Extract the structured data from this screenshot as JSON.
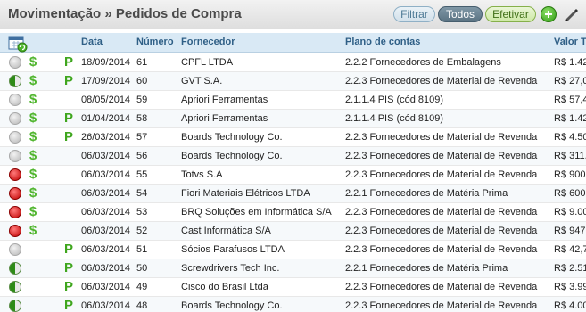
{
  "page": {
    "title": "Movimentação » Pedidos de Compra",
    "buttons": {
      "filtrar": "Filtrar",
      "todos": "Todos",
      "efetivar": "Efetivar"
    }
  },
  "columns": {
    "data": "Data",
    "numero": "Número",
    "fornecedor": "Fornecedor",
    "plano": "Plano de contas",
    "valor": "Valor T"
  },
  "colors": {
    "header_bg": "#d9e9f5",
    "header_text": "#2f5f86",
    "status_red": "#c00000",
    "status_green": "#2e8b17",
    "dollar_green": "#4fb52d"
  },
  "rows": [
    {
      "status": "gray",
      "dollar": "$",
      "p": "P",
      "date": "18/09/2014",
      "num": "61",
      "forn": "CPFL LTDA",
      "plano": "2.2.2 Fornecedores de Embalagens",
      "valor": "R$ 1.42"
    },
    {
      "status": "half",
      "dollar": "$",
      "p": "P",
      "date": "17/09/2014",
      "num": "60",
      "forn": "GVT S.A.",
      "plano": "2.2.3 Fornecedores de Material de Revenda",
      "valor": "R$ 27,0"
    },
    {
      "status": "gray",
      "dollar": "$",
      "p": "",
      "date": "08/05/2014",
      "num": "59",
      "forn": "Apriori Ferramentas",
      "plano": "2.1.1.4 PIS (cód 8109)",
      "valor": "R$ 57,4"
    },
    {
      "status": "gray",
      "dollar": "$",
      "p": "P",
      "date": "01/04/2014",
      "num": "58",
      "forn": "Apriori Ferramentas",
      "plano": "2.1.1.4 PIS (cód 8109)",
      "valor": "R$ 1.42"
    },
    {
      "status": "gray",
      "dollar": "$",
      "p": "P",
      "date": "26/03/2014",
      "num": "57",
      "forn": "Boards Technology Co.",
      "plano": "2.2.3 Fornecedores de Material de Revenda",
      "valor": "R$ 4.50"
    },
    {
      "status": "gray",
      "dollar": "$",
      "p": "",
      "date": "06/03/2014",
      "num": "56",
      "forn": "Boards Technology Co.",
      "plano": "2.2.3 Fornecedores de Material de Revenda",
      "valor": "R$ 311,"
    },
    {
      "status": "red",
      "dollar": "$",
      "p": "",
      "date": "06/03/2014",
      "num": "55",
      "forn": "Totvs S.A",
      "plano": "2.2.3 Fornecedores de Material de Revenda",
      "valor": "R$ 900,"
    },
    {
      "status": "red",
      "dollar": "$",
      "p": "",
      "date": "06/03/2014",
      "num": "54",
      "forn": "Fiori Materiais Elétricos LTDA",
      "plano": "2.2.1 Fornecedores de Matéria Prima",
      "valor": "R$ 600,"
    },
    {
      "status": "red",
      "dollar": "$",
      "p": "",
      "date": "06/03/2014",
      "num": "53",
      "forn": "BRQ Soluções em Informática S/A",
      "plano": "2.2.3 Fornecedores de Material de Revenda",
      "valor": "R$ 9.00"
    },
    {
      "status": "red",
      "dollar": "$",
      "p": "",
      "date": "06/03/2014",
      "num": "52",
      "forn": "Cast Informática S/A",
      "plano": "2.2.3 Fornecedores de Material de Revenda",
      "valor": "R$ 947,"
    },
    {
      "status": "gray",
      "dollar": "",
      "p": "P",
      "date": "06/03/2014",
      "num": "51",
      "forn": "Sócios Parafusos LTDA",
      "plano": "2.2.3 Fornecedores de Material de Revenda",
      "valor": "R$ 42,7"
    },
    {
      "status": "half",
      "dollar": "",
      "p": "P",
      "date": "06/03/2014",
      "num": "50",
      "forn": "Screwdrivers Tech Inc.",
      "plano": "2.2.1 Fornecedores de Matéria Prima",
      "valor": "R$ 2.51"
    },
    {
      "status": "half",
      "dollar": "",
      "p": "P",
      "date": "06/03/2014",
      "num": "49",
      "forn": "Cisco do Brasil Ltda",
      "plano": "2.2.3 Fornecedores de Material de Revenda",
      "valor": "R$ 3.99"
    },
    {
      "status": "half",
      "dollar": "",
      "p": "P",
      "date": "06/03/2014",
      "num": "48",
      "forn": "Boards Technology Co.",
      "plano": "2.2.3 Fornecedores de Material de Revenda",
      "valor": "R$ 4.00"
    }
  ]
}
